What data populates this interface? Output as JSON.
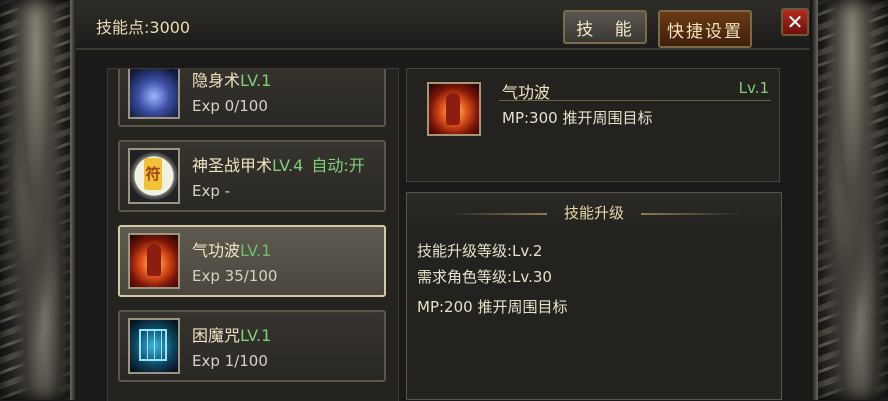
{
  "header": {
    "skill_points": "技能点:3000",
    "tab_skills": "技 能",
    "tab_shortcut": "快捷设置",
    "close_symbol": "✕"
  },
  "skills": [
    {
      "name": "隐身术",
      "level": "LV.1",
      "auto": "",
      "exp": "Exp 0/100",
      "icon": "stealth-skill-icon",
      "selected": false
    },
    {
      "name": "神圣战甲术",
      "level": "LV.4",
      "auto": "自动:开",
      "exp": "Exp -",
      "icon": "holy-armor-talisman-icon",
      "selected": false
    },
    {
      "name": "气功波",
      "level": "LV.1",
      "auto": "",
      "exp": "Exp 35/100",
      "icon": "qigong-wave-fire-icon",
      "selected": true
    },
    {
      "name": "困魔咒",
      "level": "LV.1",
      "auto": "",
      "exp": "Exp 1/100",
      "icon": "demon-cage-icon",
      "selected": false
    }
  ],
  "detail": {
    "name": "气功波",
    "level": "Lv.1",
    "description": "MP:300  推开周围目标",
    "icon": "qigong-wave-fire-icon"
  },
  "upgrade": {
    "title": "技能升级",
    "skill_level": "技能升级等级:Lv.2",
    "required_level": "需求角色等级:Lv.30",
    "description": "MP:200  推开周围目标"
  },
  "colors": {
    "level_green": "#7fd07a",
    "title_text": "#f0e3c0",
    "shortcut_tab": "#6a3a16",
    "close_red": "#b42a1f"
  }
}
